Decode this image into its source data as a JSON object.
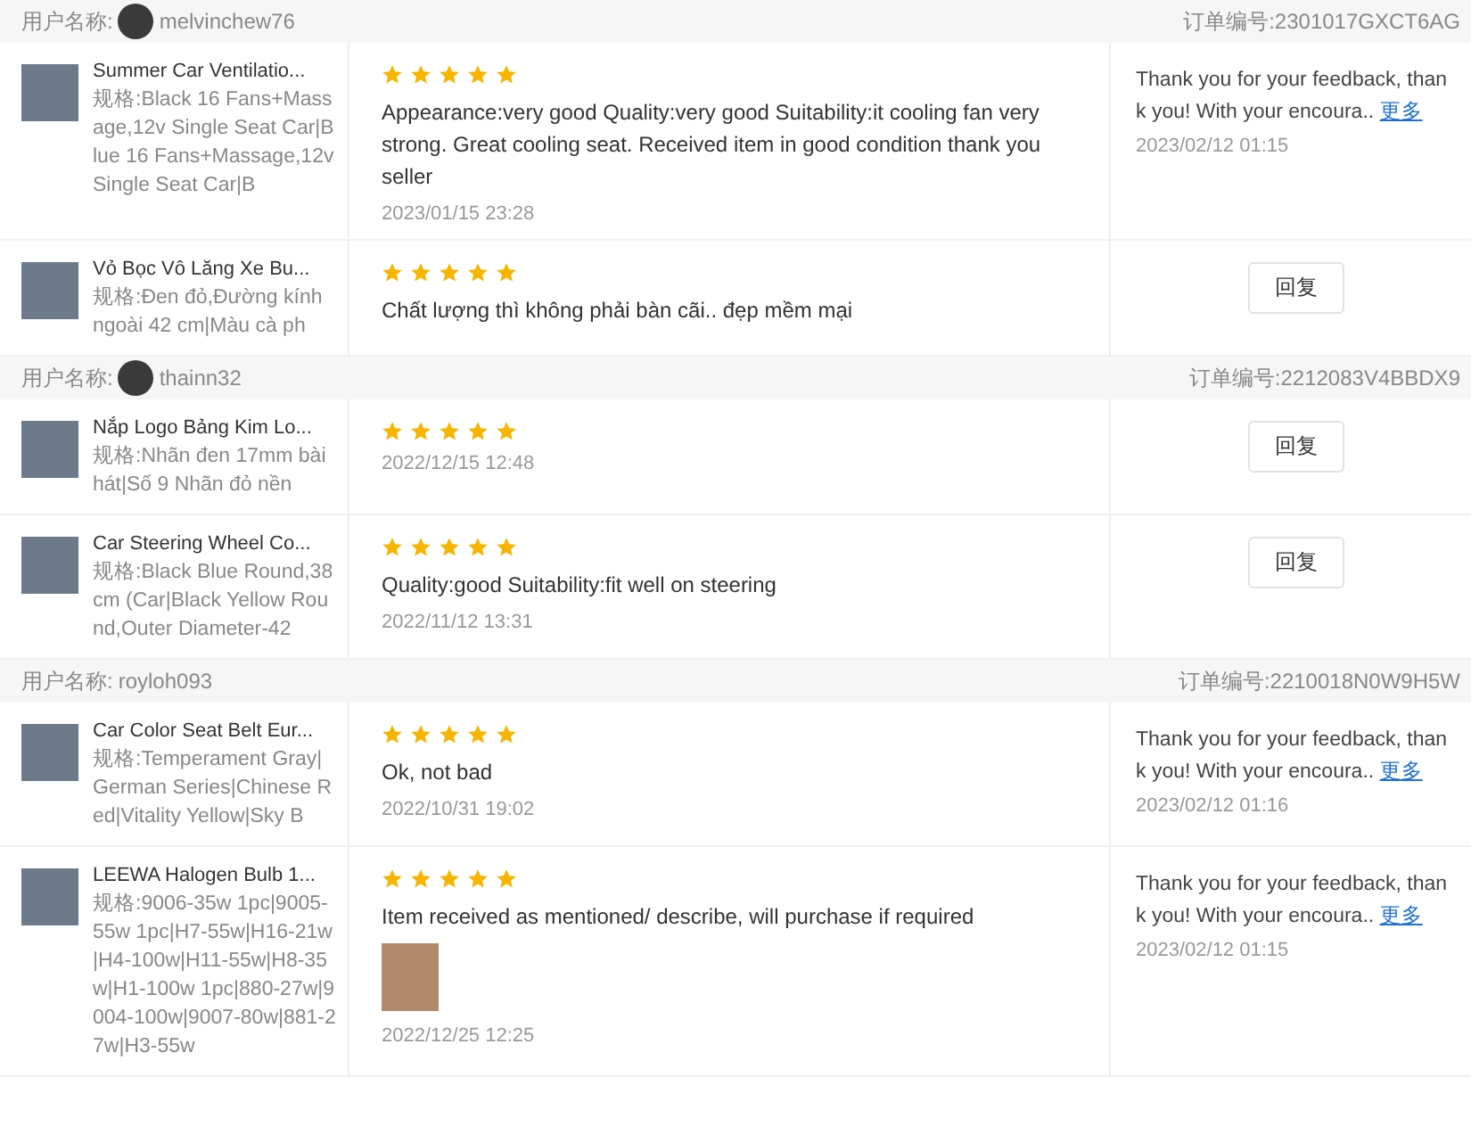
{
  "orders": [
    {
      "user_label": "用户名称:",
      "username": "melvinchew76",
      "avatar": true,
      "order_no": "订单编号:2301017GXCT6AG",
      "items": [
        {
          "title": "Summer Car Ventilatio...",
          "spec": "规格:Black 16 Fans+Massage,12v Single Seat Car|Blue 16 Fans+Massage,12v Single Seat Car|B",
          "stars": 5,
          "review": "Appearance:very good Quality:very good Suitability:it cooling fan very strong. Great cooling seat. Received item in good condition thank you seller",
          "photo": false,
          "date": "2023/01/15 23:28",
          "reply": {
            "kind": "text",
            "text": "Thank you for your feedback, thank you! With your encoura..",
            "more": "更多",
            "date": "2023/02/12 01:15"
          }
        },
        {
          "title": "Vỏ Bọc Vô Lăng Xe Bu...",
          "spec": "规格:Đen đỏ,Đường kính ngoài 42 cm|Màu cà ph",
          "stars": 5,
          "review": "Chất lượng thì không phải bàn cãi.. đẹp mềm mại",
          "photo": false,
          "reply": {
            "kind": "button",
            "label": "回复"
          }
        }
      ]
    },
    {
      "user_label": "用户名称:",
      "username": "thainn32",
      "avatar": true,
      "order_no": "订单编号:2212083V4BBDX9",
      "items": [
        {
          "title": "Nắp Logo Bảng Kim Lo...",
          "spec": "规格:Nhãn đen 17mm bài hát|Số 9 Nhãn đỏ nền",
          "stars": 5,
          "photo": false,
          "date": "2022/12/15 12:48",
          "reply": {
            "kind": "button",
            "label": "回复"
          }
        },
        {
          "title": "Car Steering Wheel Co...",
          "spec": "规格:Black Blue Round,38cm (Car|Black Yellow Round,Outer Diameter-42",
          "stars": 5,
          "review": "Quality:good Suitability:fit well on steering",
          "photo": false,
          "date": "2022/11/12 13:31",
          "reply": {
            "kind": "button",
            "label": "回复"
          }
        }
      ]
    },
    {
      "user_label": "用户名称:",
      "username": "royloh093",
      "avatar": false,
      "order_no": "订单编号:2210018N0W9H5W",
      "items": [
        {
          "title": "Car Color Seat Belt Eur...",
          "spec": "规格:Temperament Gray|German Series|Chinese Red|Vitality Yellow|Sky B",
          "stars": 5,
          "review": "Ok, not bad",
          "photo": false,
          "date": "2022/10/31 19:02",
          "reply": {
            "kind": "text",
            "text": "Thank you for your feedback, thank you! With your encoura..",
            "more": "更多",
            "date": "2023/02/12 01:16"
          }
        },
        {
          "title": "LEEWA Halogen Bulb 1...",
          "spec": "规格:9006-35w 1pc|9005-55w 1pc|H7-55w|H16-21w|H4-100w|H11-55w|H8-35w|H1-100w 1pc|880-27w|9004-100w|9007-80w|881-27w|H3-55w",
          "stars": 5,
          "review": "Item received as mentioned/ describe, will purchase if required",
          "photo": true,
          "date": "2022/12/25 12:25",
          "reply": {
            "kind": "text",
            "text": "Thank you for your feedback, thank you! With your encoura..",
            "more": "更多",
            "date": "2023/02/12 01:15"
          }
        }
      ]
    }
  ]
}
